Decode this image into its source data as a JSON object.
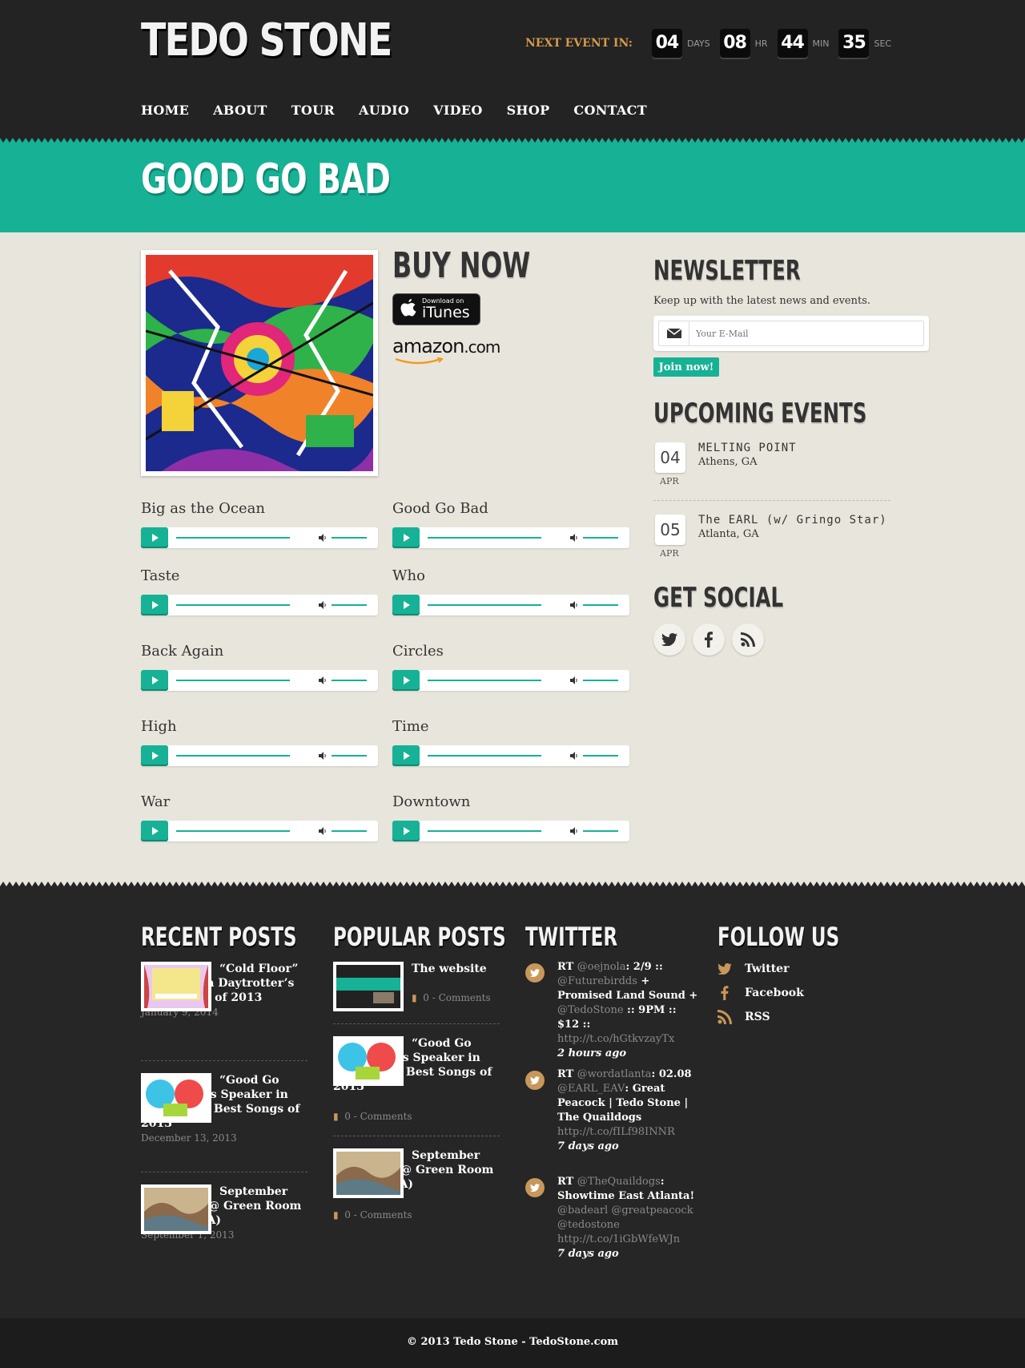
{
  "header": {
    "logo": "TEDO STONE",
    "countdown": {
      "label": "NEXT EVENT IN:",
      "days": "04",
      "days_unit": "DAYS",
      "hours": "08",
      "hours_unit": "HR",
      "mins": "44",
      "mins_unit": "MIN",
      "secs": "35",
      "secs_unit": "SEC"
    },
    "nav": [
      "HOME",
      "ABOUT",
      "TOUR",
      "AUDIO",
      "VIDEO",
      "SHOP",
      "CONTACT"
    ]
  },
  "page": {
    "title": "GOOD GO BAD"
  },
  "buy": {
    "heading": "BUY NOW",
    "itunes_small": "Download on",
    "itunes_big": "iTunes",
    "amazon_word": "amazon",
    "amazon_tld": ".com"
  },
  "tracks": [
    "Big as the Ocean",
    "Good Go Bad",
    "Taste",
    "Who",
    "Back Again",
    "Circles",
    "High",
    "Time",
    "War",
    "Downtown"
  ],
  "newsletter": {
    "heading": "NEWSLETTER",
    "text": "Keep up with the latest news and events.",
    "placeholder": "Your E-Mail",
    "button": "Join now!"
  },
  "events": {
    "heading": "UPCOMING EVENTS",
    "items": [
      {
        "day": "04",
        "month": "APR",
        "title": "MELTING POINT",
        "location": "Athens, GA"
      },
      {
        "day": "05",
        "month": "APR",
        "title": "The EARL (w/ Gringo Star)",
        "location": "Atlanta, GA"
      }
    ]
  },
  "social": {
    "heading": "GET SOCIAL",
    "icons": [
      "twitter-icon",
      "facebook-icon",
      "rss-icon"
    ]
  },
  "footer": {
    "recent": {
      "heading": "RECENT POSTS",
      "posts": [
        {
          "title": "“Cold Floor” Featured In Daytrotter’s Best Songs of 2013",
          "date": "January 9, 2014"
        },
        {
          "title": "“Good Go Bad” Makes Speaker in Code’s 150 Best Songs of 2013",
          "date": "December 13, 2013"
        },
        {
          "title": "September Residency @ Green Room (Athens, GA)",
          "date": "September 1, 2013"
        }
      ]
    },
    "popular": {
      "heading": "POPULAR POSTS",
      "posts": [
        {
          "title": "The website is here!",
          "comments": "0 - Comments"
        },
        {
          "title": "“Good Go Bad” Makes Speaker in Code’s 150 Best Songs of 2013",
          "comments": "0 - Comments"
        },
        {
          "title": "September Residency @ Green Room (Athens, GA)",
          "comments": "0 - Comments"
        }
      ]
    },
    "twitter": {
      "heading": "TWITTER",
      "tweets": [
        {
          "rt": "RT ",
          "h1": "@oejnola",
          "t1": ": 2/9 :: ",
          "h2": "@Futurebirdds",
          "t2": " + Promised Land Sound + ",
          "h3": "@TedoStone",
          "t3": " :: 9PM :: $12 :: ",
          "url": "http://t.co/hGtkvzayTx",
          "time": "2 hours ago"
        },
        {
          "rt": "RT ",
          "h1": "@wordatlanta",
          "t1": ": 02.08 ",
          "h2": "@EARL_EAV",
          "t2": ": Great Peacock | Tedo Stone | The Quaildogs ",
          "h3": "",
          "t3": "",
          "url": "http://t.co/fILf98INNR",
          "time": "7 days ago"
        },
        {
          "rt": "RT ",
          "h1": "@TheQuaildogs",
          "t1": ": Showtime East Atlanta! ",
          "h2": "@badearl @greatpeacock @tedostone",
          "t2": " ",
          "h3": "",
          "t3": "",
          "url": "http://t.co/1iGbWfeWJn",
          "time": "7 days ago"
        }
      ]
    },
    "follow": {
      "heading": "FOLLOW US",
      "items": [
        "Twitter",
        "Facebook",
        "RSS"
      ]
    },
    "copyright": "© 2013 Tedo Stone - TedoStone.com"
  },
  "colors": {
    "accent": "#17b196",
    "dark": "#232323",
    "paper": "#e8e6dc",
    "orange": "#d79a4a"
  }
}
